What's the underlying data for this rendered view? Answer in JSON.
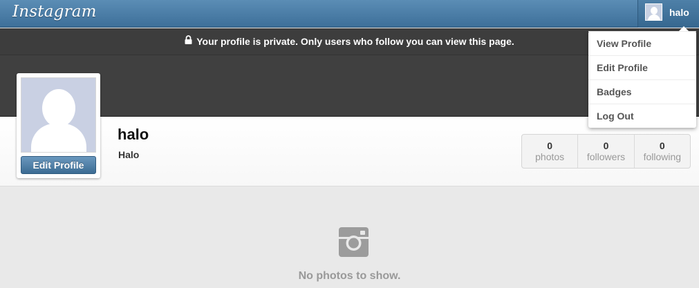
{
  "header": {
    "logo": "Instagram",
    "user_name": "halo"
  },
  "privacy_notice": "Your profile is private. Only users who follow you can view this page.",
  "profile": {
    "username": "halo",
    "full_name": "Halo",
    "edit_label": "Edit Profile",
    "stats": [
      {
        "value": "0",
        "label": "photos"
      },
      {
        "value": "0",
        "label": "followers"
      },
      {
        "value": "0",
        "label": "following"
      }
    ]
  },
  "empty_state": {
    "message": "No photos to show."
  },
  "dropdown": {
    "items": [
      {
        "label": "View Profile"
      },
      {
        "label": "Edit Profile"
      },
      {
        "label": "Badges"
      },
      {
        "label": "Log Out"
      }
    ]
  },
  "colors": {
    "brand_blue": "#3d6f99",
    "dark_band": "#404040",
    "page_bg": "#e9e9e9"
  }
}
